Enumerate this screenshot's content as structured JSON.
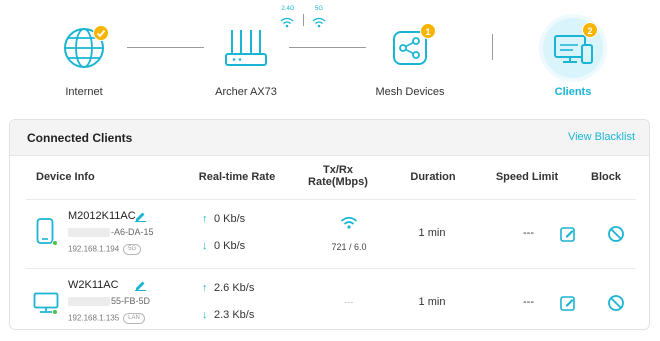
{
  "topology": {
    "nodes": [
      {
        "label": "Internet",
        "icon": "globe-icon",
        "status": "check"
      },
      {
        "label": "Archer AX73",
        "icon": "router-icon"
      },
      {
        "label": "Mesh Devices",
        "icon": "mesh-icon",
        "badge": "1"
      },
      {
        "label": "Clients",
        "icon": "clients-icon",
        "badge": "2",
        "active": true
      }
    ],
    "bands": [
      "2.4G",
      "5G"
    ]
  },
  "panel": {
    "title": "Connected Clients",
    "link": "View Blacklist"
  },
  "columns": {
    "device_info": "Device Info",
    "realtime_rate": "Real-time Rate",
    "txrx_line1": "Tx/Rx",
    "txrx_line2": "Rate(Mbps)",
    "duration": "Duration",
    "speed_limit": "Speed Limit",
    "block": "Block"
  },
  "clients": [
    {
      "name": "M2012K11AC",
      "mac_suffix": "-A6-DA-15",
      "ip": "192.168.1.194",
      "band": "5G",
      "device_type": "phone-icon",
      "up_rate": "0 Kb/s",
      "down_rate": "0 Kb/s",
      "txrx": "721 / 6.0",
      "duration": "1 min",
      "speed_limit": "---"
    },
    {
      "name": "W2K11AC",
      "mac_suffix": "55-FB-5D",
      "ip": "192.168.1.135",
      "band": "LAN",
      "device_type": "desktop-icon",
      "up_rate": "2.6 Kb/s",
      "down_rate": "2.3 Kb/s",
      "txrx": "---",
      "duration": "1 min",
      "speed_limit": "---"
    }
  ],
  "colors": {
    "accent": "#1ab4d4",
    "badge": "#f7b500",
    "online": "#4bc24b"
  }
}
